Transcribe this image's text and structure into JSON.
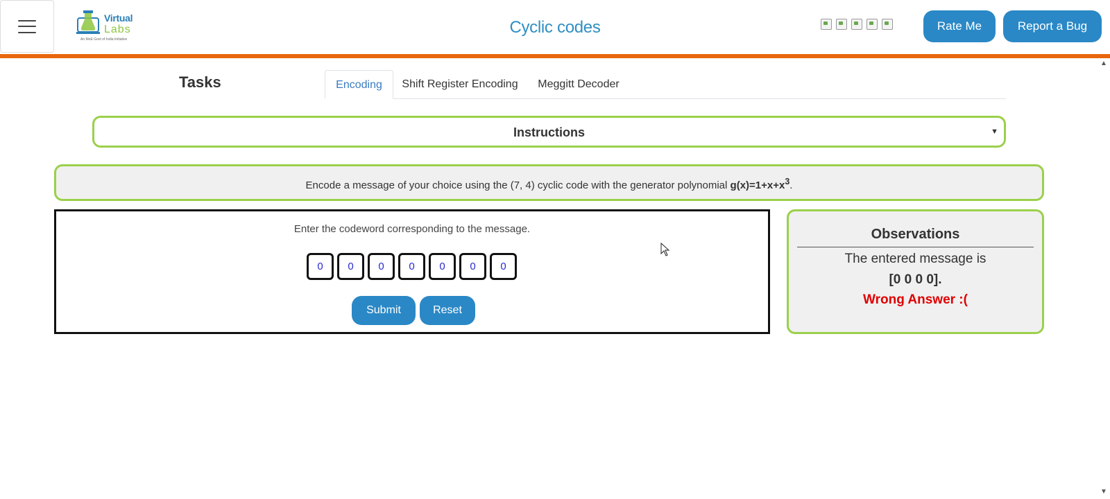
{
  "header": {
    "title": "Cyclic codes",
    "logo": {
      "line1": "Virtual",
      "line2": "Labs",
      "tagline": "An MoE Govt of India Initiative"
    },
    "rating_images": [
      "star",
      "star",
      "star",
      "star",
      "star"
    ],
    "rate_button": "Rate Me",
    "bug_button": "Report a Bug",
    "accent_color": "#e8670c"
  },
  "tasks": {
    "title": "Tasks",
    "tabs": [
      {
        "label": "Encoding",
        "active": true
      },
      {
        "label": "Shift Register Encoding",
        "active": false
      },
      {
        "label": "Meggitt Decoder",
        "active": false
      }
    ]
  },
  "instructions": {
    "label": "Instructions"
  },
  "problem": {
    "text_before": "Encode a message of your choice using the (7, 4) cyclic code with the generator polynomial ",
    "poly": "g(x)=1+x+x",
    "exponent": "3",
    "text_after": "."
  },
  "panel": {
    "prompt": "Enter the codeword corresponding to the message.",
    "bits": [
      "0",
      "0",
      "0",
      "0",
      "0",
      "0",
      "0"
    ],
    "submit_label": "Submit",
    "reset_label": "Reset"
  },
  "observations": {
    "title": "Observations",
    "line1": "The entered message is",
    "line2": "[0 0 0 0].",
    "result": "Wrong Answer :(",
    "result_color": "#e00000"
  },
  "colors": {
    "primary_button": "#2a88c6",
    "box_border": "#9bd04a",
    "title": "#2f8fc3"
  }
}
